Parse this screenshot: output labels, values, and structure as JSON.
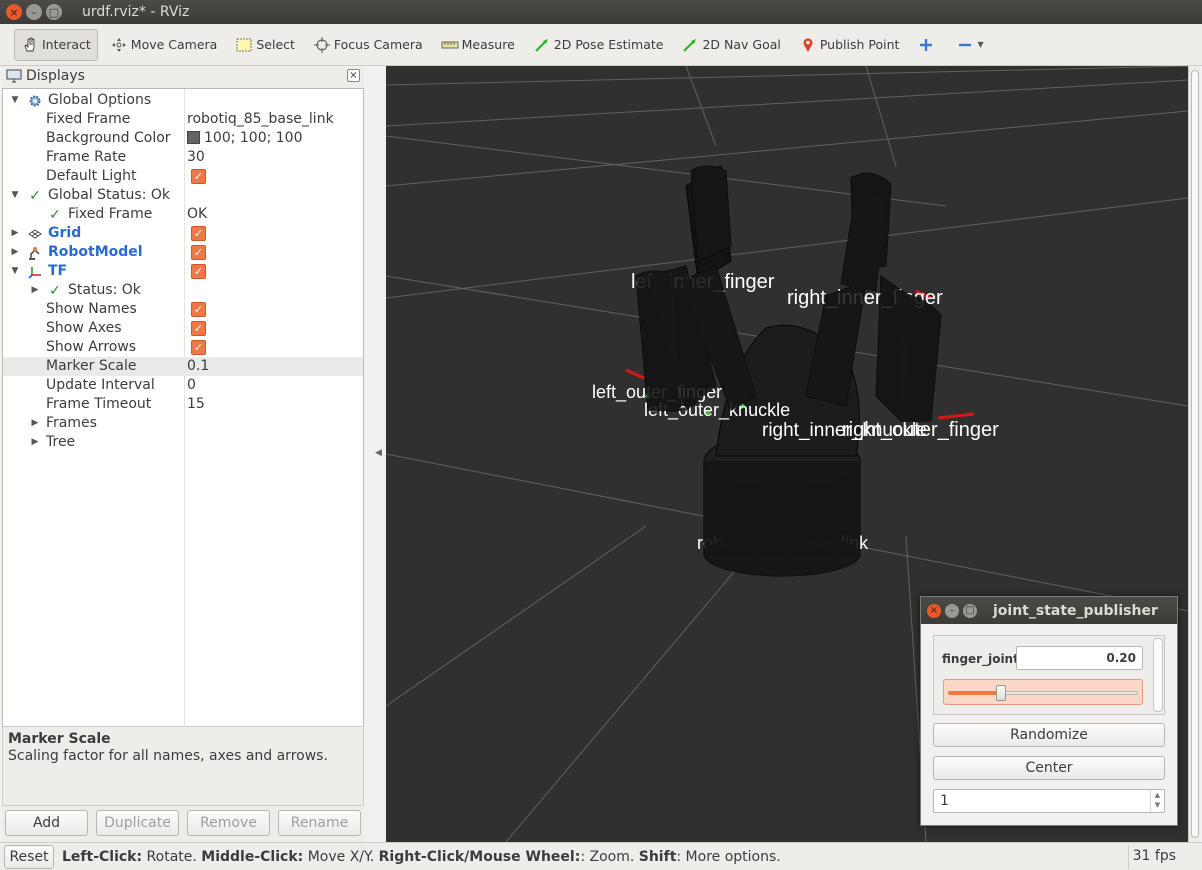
{
  "window": {
    "title": "urdf.rviz* - RViz"
  },
  "toolbar": {
    "tools": [
      {
        "label": "Interact",
        "icon": "hand-icon"
      },
      {
        "label": "Move Camera",
        "icon": "move-camera-icon"
      },
      {
        "label": "Select",
        "icon": "select-icon"
      },
      {
        "label": "Focus Camera",
        "icon": "focus-camera-icon"
      },
      {
        "label": "Measure",
        "icon": "ruler-icon"
      },
      {
        "label": "2D Pose Estimate",
        "icon": "pose-arrow-icon"
      },
      {
        "label": "2D Nav Goal",
        "icon": "nav-arrow-icon"
      },
      {
        "label": "Publish Point",
        "icon": "pin-icon"
      }
    ],
    "add_tool_icon": "plus-icon",
    "remove_tool_icon": "minus-icon"
  },
  "displays": {
    "title": "Displays",
    "rows": [
      {
        "label": "Global Options"
      },
      {
        "label": "Fixed Frame",
        "value": "robotiq_85_base_link"
      },
      {
        "label": "Background Color",
        "value": "100; 100; 100"
      },
      {
        "label": "Frame Rate",
        "value": "30"
      },
      {
        "label": "Default Light"
      },
      {
        "label": "Global Status: Ok"
      },
      {
        "label": "Fixed Frame",
        "value": "OK"
      },
      {
        "label": "Grid"
      },
      {
        "label": "RobotModel"
      },
      {
        "label": "TF"
      },
      {
        "label": "Status: Ok"
      },
      {
        "label": "Show Names"
      },
      {
        "label": "Show Axes"
      },
      {
        "label": "Show Arrows"
      },
      {
        "label": "Marker Scale",
        "value": "0.1"
      },
      {
        "label": "Update Interval",
        "value": "0"
      },
      {
        "label": "Frame Timeout",
        "value": "15"
      },
      {
        "label": "Frames"
      },
      {
        "label": "Tree"
      }
    ],
    "description": {
      "title": "Marker Scale",
      "text": "Scaling factor for all names, axes and arrows."
    },
    "buttons": {
      "add": "Add",
      "duplicate": "Duplicate",
      "remove": "Remove",
      "rename": "Rename"
    }
  },
  "colors": {
    "accent": "#f07746",
    "link_blue": "#2a6ad0",
    "background_color_swatch": "#646464",
    "view_background": "#303030"
  },
  "jsp": {
    "title": "joint_state_publisher",
    "joint_name": "finger_joint",
    "joint_value": "0.20",
    "slider_fraction": 0.28,
    "randomize": "Randomize",
    "center": "Center",
    "spin_value": "1"
  },
  "status": {
    "reset": "Reset",
    "left_click": "Left-Click:",
    "left_click_action": " Rotate. ",
    "middle_click": "Middle-Click:",
    "middle_click_action": " Move X/Y. ",
    "right_click": "Right-Click/Mouse Wheel:",
    "right_click_action": ": Zoom. ",
    "shift": "Shift",
    "shift_action": ": More options.",
    "fps": "31 fps"
  },
  "scene_labels": [
    "left_inner_finger",
    "right_inner_finger",
    "left_outer_finger",
    "left_outer_knuckle",
    "right_inner_knuckle",
    "right_outer_finger",
    "robotiq_85_base_link"
  ]
}
